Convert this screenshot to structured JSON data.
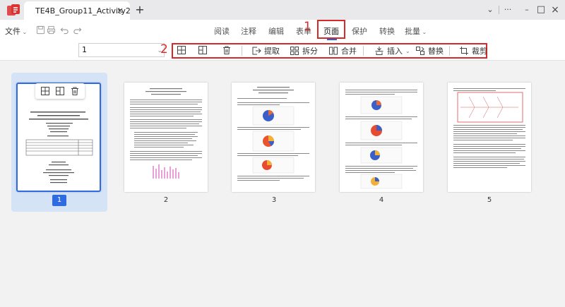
{
  "window": {
    "tab_title": "TE4B_Group11_Activity2",
    "tab_close": "×",
    "tab_add": "+",
    "dropdown": "⌄",
    "more": "···",
    "minimize": "–",
    "maximize": "□",
    "close": "×"
  },
  "menubar": {
    "file": "文件",
    "items": [
      "阅读",
      "注释",
      "编辑",
      "表单",
      "页面",
      "保护",
      "转换",
      "批量"
    ],
    "active": "页面",
    "annotation_1": "1"
  },
  "toolbar": {
    "page_value": "1",
    "annotation_2": "2",
    "tools": {
      "extract": "提取",
      "split": "拆分",
      "merge": "合并",
      "insert": "插入",
      "replace": "替换",
      "crop": "裁剪"
    }
  },
  "pages": [
    {
      "label": "1",
      "selected": true
    },
    {
      "label": "2",
      "selected": false
    },
    {
      "label": "3",
      "selected": false
    },
    {
      "label": "4",
      "selected": false
    },
    {
      "label": "5",
      "selected": false
    }
  ],
  "colors": {
    "accent": "#2f6be0",
    "annotation_red": "#d42a2a",
    "selection_bg": "#d5e3f7"
  }
}
